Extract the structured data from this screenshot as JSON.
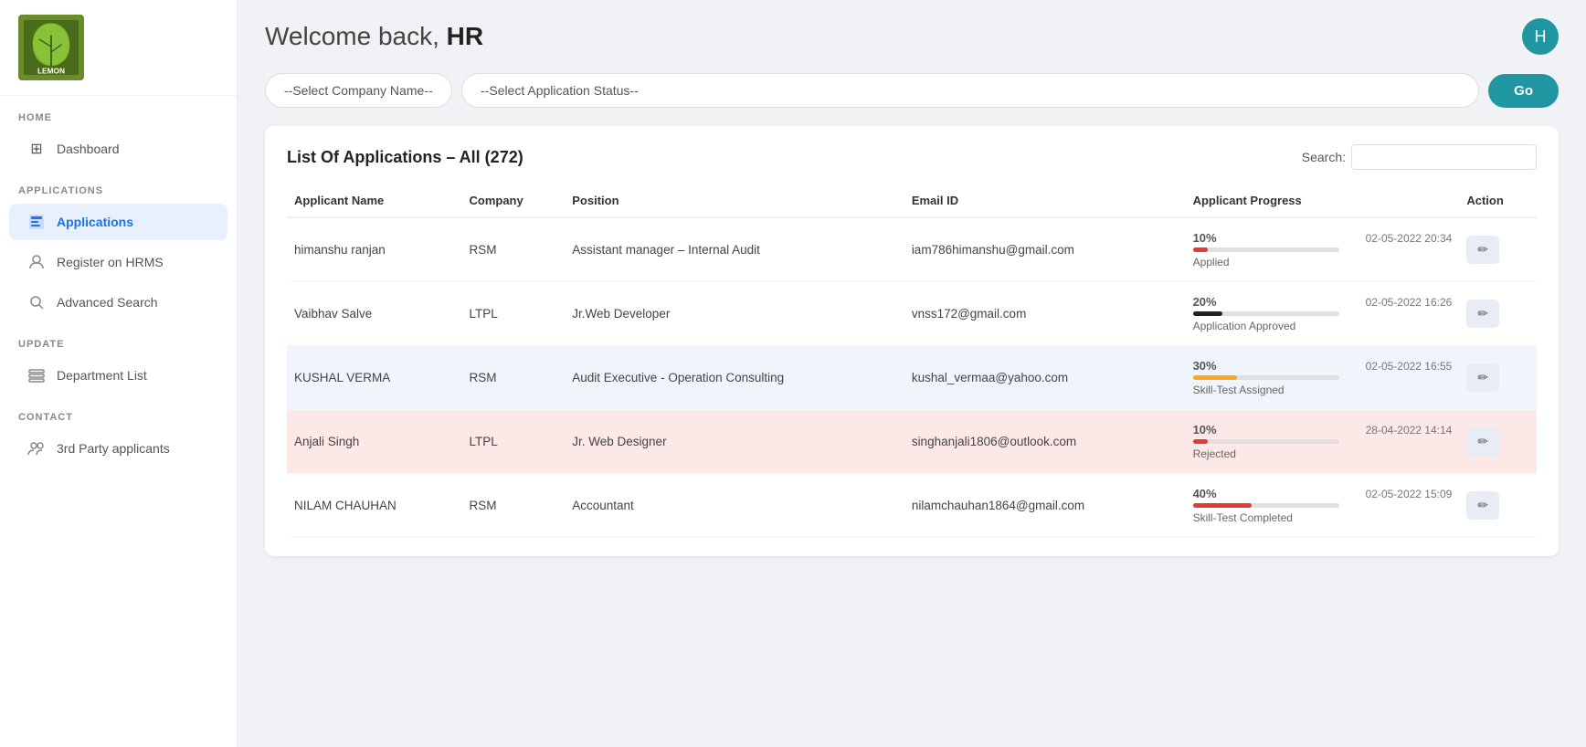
{
  "sidebar": {
    "logo_text": "LEMON",
    "sections": [
      {
        "label": "HOME",
        "items": [
          {
            "id": "dashboard",
            "label": "Dashboard",
            "icon": "⊞",
            "active": false
          }
        ]
      },
      {
        "label": "APPLICATIONS",
        "items": [
          {
            "id": "applications",
            "label": "Applications",
            "icon": "📋",
            "active": true
          },
          {
            "id": "register-hrms",
            "label": "Register on HRMS",
            "icon": "👤",
            "active": false
          },
          {
            "id": "advanced-search",
            "label": "Advanced Search",
            "icon": "🔍",
            "active": false
          }
        ]
      },
      {
        "label": "UPDATE",
        "items": [
          {
            "id": "department-list",
            "label": "Department List",
            "icon": "🗂",
            "active": false
          }
        ]
      },
      {
        "label": "CONTACT",
        "items": [
          {
            "id": "3rd-party",
            "label": "3rd Party applicants",
            "icon": "👥",
            "active": false
          }
        ]
      }
    ]
  },
  "header": {
    "welcome": "Welcome back, ",
    "username": "HR",
    "avatar_letter": "H"
  },
  "filters": {
    "company_placeholder": "--Select Company Name--",
    "status_placeholder": "--Select Application Status--",
    "go_label": "Go"
  },
  "table": {
    "title": "List Of Applications – All (272)",
    "search_label": "Search:",
    "search_value": "",
    "columns": [
      "Applicant Name",
      "Company",
      "Position",
      "Email ID",
      "Applicant Progress",
      "Action"
    ],
    "rows": [
      {
        "name": "himanshu ranjan",
        "company": "RSM",
        "position": "Assistant manager – Internal Audit",
        "email": "iam786himanshu@gmail.com",
        "progress_pct": "10%",
        "progress_date": "02-05-2022 20:34",
        "progress_status": "Applied",
        "progress_color": "#e53935",
        "row_class": "row-normal"
      },
      {
        "name": "Vaibhav Salve",
        "company": "LTPL",
        "position": "Jr.Web Developer",
        "email": "vnss172@gmail.com",
        "progress_pct": "20%",
        "progress_date": "02-05-2022 16:26",
        "progress_status": "Application Approved",
        "progress_color": "#222222",
        "row_class": "row-normal"
      },
      {
        "name": "KUSHAL VERMA",
        "company": "RSM",
        "position": "Audit Executive - Operation Consulting",
        "email": "kushal_vermaa@yahoo.com",
        "progress_pct": "30%",
        "progress_date": "02-05-2022 16:55",
        "progress_status": "Skill-Test Assigned",
        "progress_color": "#f9a825",
        "row_class": "row-highlight-blue"
      },
      {
        "name": "Anjali Singh",
        "company": "LTPL",
        "position": "Jr. Web Designer",
        "email": "singhanjali1806@outlook.com",
        "progress_pct": "10%",
        "progress_date": "28-04-2022 14:14",
        "progress_status": "Rejected",
        "progress_color": "#e53935",
        "row_class": "row-highlight-pink"
      },
      {
        "name": "NILAM CHAUHAN",
        "company": "RSM",
        "position": "Accountant",
        "email": "nilamchauhan1864@gmail.com",
        "progress_pct": "40%",
        "progress_date": "02-05-2022 15:09",
        "progress_status": "Skill-Test Completed",
        "progress_color": "#e53935",
        "row_class": "row-normal"
      }
    ],
    "action_icon": "✏"
  }
}
